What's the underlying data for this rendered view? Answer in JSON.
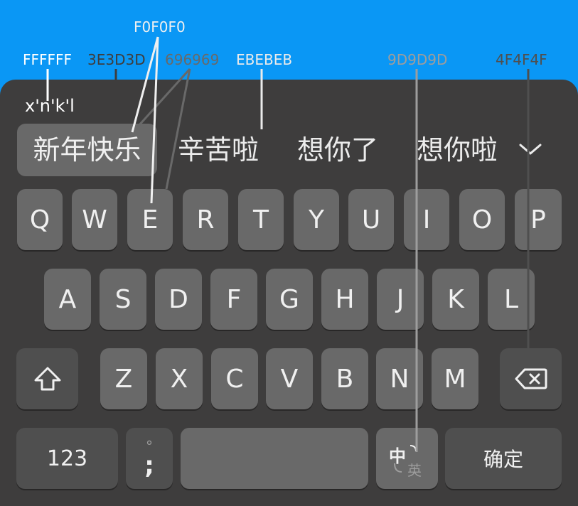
{
  "annotations": {
    "c1": "FFFFFF",
    "c2": "3E3D3D",
    "c3": "696969",
    "c4": "F0F0F0",
    "c5": "EBEBEB",
    "c6": "9D9D9D",
    "c7": "4F4F4F"
  },
  "colors": {
    "background": "#0a97f5",
    "keyboard": "#3e3d3d",
    "key": "#696969",
    "key_text": "#f0f0f0",
    "func_key": "#4f4f4f",
    "candidate_text": "#ebebeb",
    "dim_text": "#9d9d9d",
    "pinyin_text": "#ffffff"
  },
  "pinyin": "x'n'k'l",
  "candidates": [
    "新年快乐",
    "辛苦啦",
    "想你了",
    "想你啦"
  ],
  "expand_icon": "chevron-down-icon",
  "rows": {
    "row1": [
      "Q",
      "W",
      "E",
      "R",
      "T",
      "Y",
      "U",
      "I",
      "O",
      "P"
    ],
    "row2": [
      "A",
      "S",
      "D",
      "F",
      "G",
      "H",
      "J",
      "K",
      "L"
    ],
    "row3": [
      "Z",
      "X",
      "C",
      "V",
      "B",
      "N",
      "M"
    ]
  },
  "shift_icon": "shift-icon",
  "backspace_icon": "backspace-icon",
  "bottom": {
    "num": "123",
    "punct_top": "°",
    "punct_bottom": ";",
    "lang_zh": "中",
    "lang_en": "英",
    "confirm": "确定"
  }
}
